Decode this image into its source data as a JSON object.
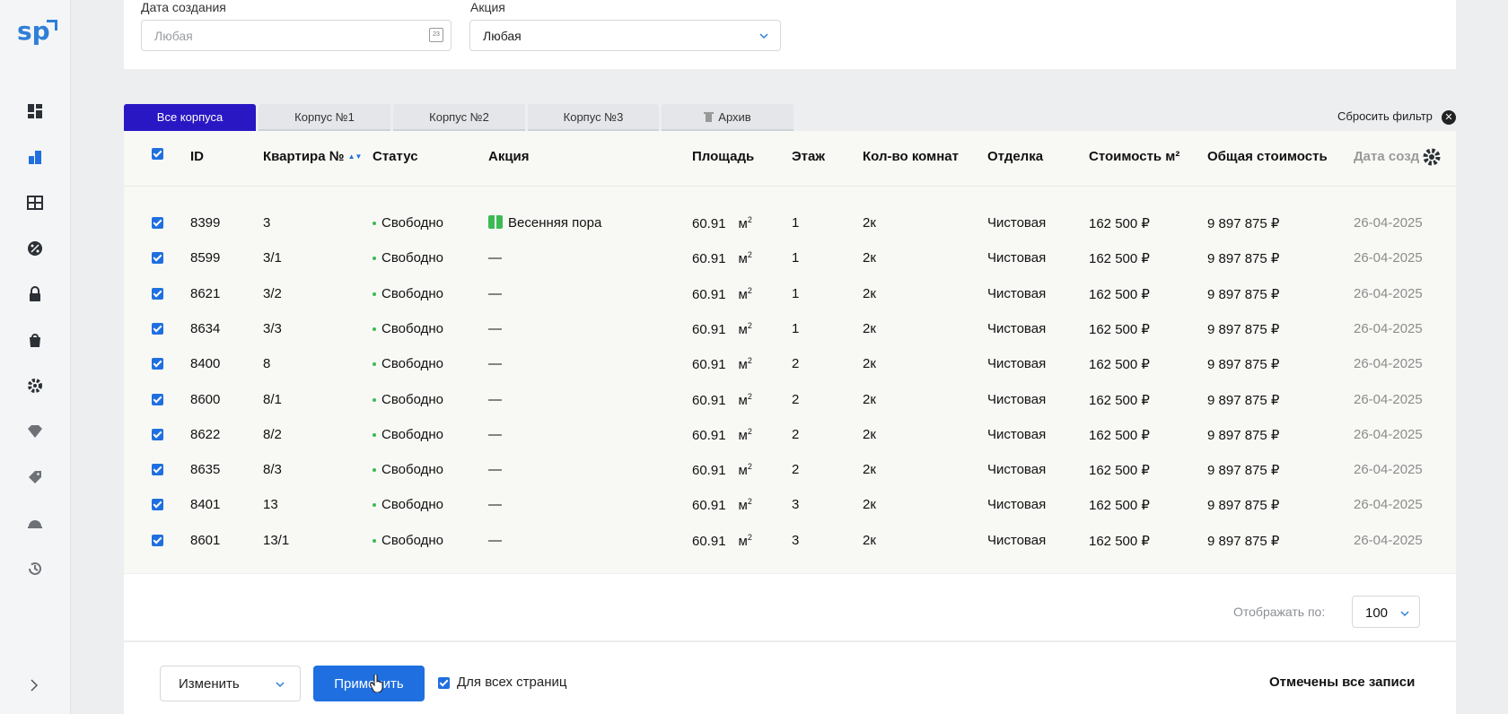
{
  "logo": "sp",
  "filters": {
    "created_label": "Дата создания",
    "created_value": "Любая",
    "promo_label": "Акция",
    "promo_value": "Любая"
  },
  "tabs": [
    {
      "label": "Все корпуса",
      "active": true
    },
    {
      "label": "Корпус №1"
    },
    {
      "label": "Корпус №2"
    },
    {
      "label": "Корпус №3"
    },
    {
      "label": "Архив",
      "icon": "trash-icon"
    }
  ],
  "reset_filter": "Сбросить фильтр",
  "table": {
    "headers": [
      "ID",
      "Квартира №",
      "Статус",
      "Акция",
      "Площадь",
      "Этаж",
      "Кол-во комнат",
      "Отделка",
      "Стоимость м²",
      "Общая стоимость",
      "Дата созд"
    ],
    "rows": [
      {
        "id": "8399",
        "apt": "3",
        "status": "Свободно",
        "promo": "Весенняя пора",
        "area": "60.91",
        "unit": "м",
        "floor": "1",
        "rooms": "2к",
        "finish": "Чистовая",
        "price_m2": "162 500 ₽",
        "total": "9 897 875 ₽",
        "date": "26-04-2025"
      },
      {
        "id": "8599",
        "apt": "3/1",
        "status": "Свободно",
        "promo": "—",
        "area": "60.91",
        "unit": "м",
        "floor": "1",
        "rooms": "2к",
        "finish": "Чистовая",
        "price_m2": "162 500 ₽",
        "total": "9 897 875 ₽",
        "date": "26-04-2025"
      },
      {
        "id": "8621",
        "apt": "3/2",
        "status": "Свободно",
        "promo": "—",
        "area": "60.91",
        "unit": "м",
        "floor": "1",
        "rooms": "2к",
        "finish": "Чистовая",
        "price_m2": "162 500 ₽",
        "total": "9 897 875 ₽",
        "date": "26-04-2025"
      },
      {
        "id": "8634",
        "apt": "3/3",
        "status": "Свободно",
        "promo": "—",
        "area": "60.91",
        "unit": "м",
        "floor": "1",
        "rooms": "2к",
        "finish": "Чистовая",
        "price_m2": "162 500 ₽",
        "total": "9 897 875 ₽",
        "date": "26-04-2025"
      },
      {
        "id": "8400",
        "apt": "8",
        "status": "Свободно",
        "promo": "—",
        "area": "60.91",
        "unit": "м",
        "floor": "2",
        "rooms": "2к",
        "finish": "Чистовая",
        "price_m2": "162 500 ₽",
        "total": "9 897 875 ₽",
        "date": "26-04-2025"
      },
      {
        "id": "8600",
        "apt": "8/1",
        "status": "Свободно",
        "promo": "—",
        "area": "60.91",
        "unit": "м",
        "floor": "2",
        "rooms": "2к",
        "finish": "Чистовая",
        "price_m2": "162 500 ₽",
        "total": "9 897 875 ₽",
        "date": "26-04-2025"
      },
      {
        "id": "8622",
        "apt": "8/2",
        "status": "Свободно",
        "promo": "—",
        "area": "60.91",
        "unit": "м",
        "floor": "2",
        "rooms": "2к",
        "finish": "Чистовая",
        "price_m2": "162 500 ₽",
        "total": "9 897 875 ₽",
        "date": "26-04-2025"
      },
      {
        "id": "8635",
        "apt": "8/3",
        "status": "Свободно",
        "promo": "—",
        "area": "60.91",
        "unit": "м",
        "floor": "2",
        "rooms": "2к",
        "finish": "Чистовая",
        "price_m2": "162 500 ₽",
        "total": "9 897 875 ₽",
        "date": "26-04-2025"
      },
      {
        "id": "8401",
        "apt": "13",
        "status": "Свободно",
        "promo": "—",
        "area": "60.91",
        "unit": "м",
        "floor": "3",
        "rooms": "2к",
        "finish": "Чистовая",
        "price_m2": "162 500 ₽",
        "total": "9 897 875 ₽",
        "date": "26-04-2025"
      },
      {
        "id": "8601",
        "apt": "13/1",
        "status": "Свободно",
        "promo": "—",
        "area": "60.91",
        "unit": "м",
        "floor": "3",
        "rooms": "2к",
        "finish": "Чистовая",
        "price_m2": "162 500 ₽",
        "total": "9 897 875 ₽",
        "date": "26-04-2025"
      }
    ]
  },
  "pager": {
    "label": "Отображать по:",
    "value": "100"
  },
  "bottom": {
    "change_label": "Изменить",
    "apply_label": "Применить",
    "all_pages_label": "Для всех страниц",
    "status": "Отмечены все записи"
  },
  "colors": {
    "accent": "#1f6fe0",
    "tab_active": "#2a17c4",
    "status_ok": "#3cba54"
  }
}
